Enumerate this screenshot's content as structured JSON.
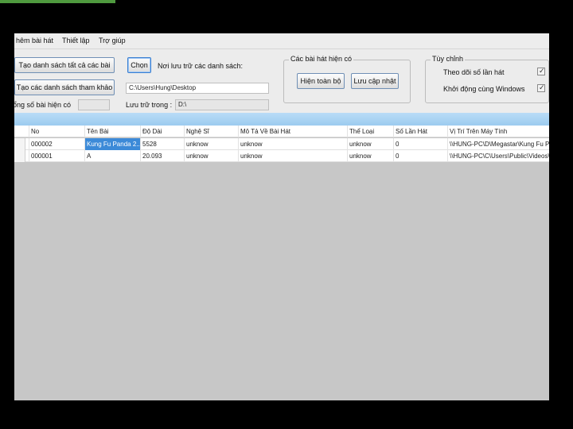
{
  "menu": [
    "hêm bài hát",
    "Thiết lập",
    "Trợ giúp"
  ],
  "toolbar": {
    "btn_all": "Tạo danh sách tất cả các bài",
    "btn_ref": "Tạo các danh sách tham khảo",
    "btn_choose": "Chọn",
    "save_label": "Nơi lưu trữ các danh sách:",
    "path_value": "C:\\Users\\Hung\\Desktop",
    "total_label": "ổng số bài hiện có",
    "total_value": "",
    "store_label": "Lưu trữ trong :",
    "store_value": "D:\\"
  },
  "songs_group": {
    "title": "Các bài hát hiện có",
    "btn_show_all": "Hiện toàn bộ",
    "btn_update": "Lưu cập nhật"
  },
  "options_group": {
    "title": "Tùy chỉnh",
    "track_label": "Theo dõi số lần hát",
    "startup_label": "Khởi động cùng Windows"
  },
  "table": {
    "columns": [
      "No",
      "Tên Bài",
      "Độ Dài",
      "Nghệ Sĩ",
      "Mô Tả Về Bài Hát",
      "Thể Loại",
      "Số Lần Hát",
      "Vị Trí Trên Máy Tính"
    ],
    "rows": [
      [
        "000002",
        "Kung Fu Panda 2...",
        "5528",
        "unknow",
        "unknow",
        "unknow",
        "0",
        "\\\\HUNG-PC\\D\\Megastar\\Kung Fu Pa"
      ],
      [
        "000001",
        "A",
        "20.093",
        "unknow",
        "unknow",
        "unknow",
        "0",
        "\\\\HUNG-PC\\C\\Users\\Public\\Videos\\S"
      ]
    ]
  }
}
